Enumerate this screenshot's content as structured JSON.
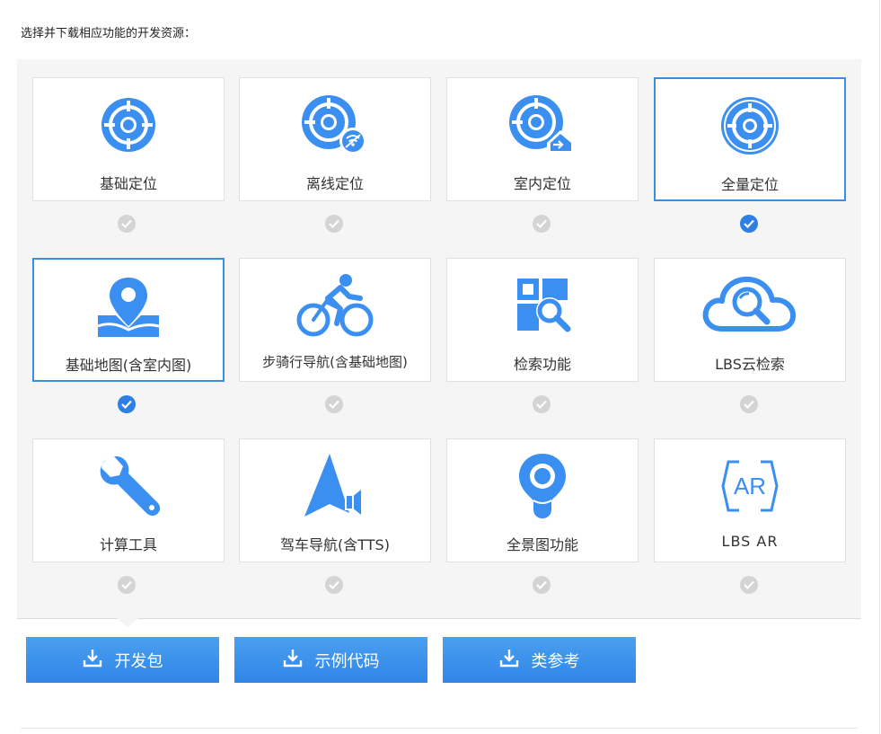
{
  "heading": "选择并下载相应功能的开发资源：",
  "features": [
    {
      "label": "基础定位",
      "icon": "locate-icon",
      "selected": false
    },
    {
      "label": "离线定位",
      "icon": "offline-locate-icon",
      "selected": false
    },
    {
      "label": "室内定位",
      "icon": "indoor-locate-icon",
      "selected": false
    },
    {
      "label": "全量定位",
      "icon": "full-locate-icon",
      "selected": true
    },
    {
      "label": "基础地图(含室内图)",
      "icon": "map-pin-icon",
      "selected": true
    },
    {
      "label": "步骑行导航(含基础地图)",
      "icon": "bicycle-icon",
      "selected": false
    },
    {
      "label": "检索功能",
      "icon": "search-grid-icon",
      "selected": false
    },
    {
      "label": "LBS云检索",
      "icon": "cloud-search-icon",
      "selected": false
    },
    {
      "label": "计算工具",
      "icon": "wrench-icon",
      "selected": false
    },
    {
      "label": "驾车导航(含TTS)",
      "icon": "navigation-arrow-icon",
      "selected": false
    },
    {
      "label": "全景图功能",
      "icon": "panorama-pin-icon",
      "selected": false
    },
    {
      "label": "LBS AR",
      "icon": "ar-icon",
      "selected": false
    }
  ],
  "ar_badge": "AR",
  "buttons": {
    "sdk": "开发包",
    "sample": "示例代码",
    "reference": "类参考"
  },
  "colors": {
    "accent": "#2d7fe3",
    "icon": "#3b8ff0",
    "check_off": "#d4d4d4"
  }
}
